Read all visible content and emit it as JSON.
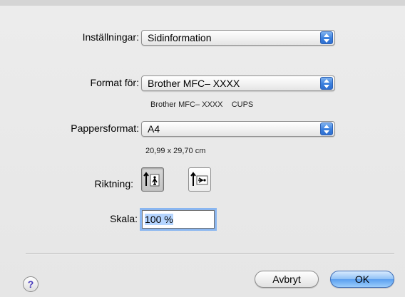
{
  "page_setup": {
    "settings_label": "Inställningar:",
    "settings_value": "Sidinformation",
    "format_for_label": "Format för:",
    "format_for_value": "Brother MFC– XXXX",
    "printer_info": "Brother MFC– XXXX    CUPS",
    "paper_size_label": "Pappersformat:",
    "paper_size_value": "A4",
    "paper_dimensions": "20,99 x 29,70 cm",
    "orientation_label": "Riktning:",
    "orientation_selected": "portrait",
    "scale_label": "Skala:",
    "scale_value": "100 %"
  },
  "footer": {
    "help_label": "?",
    "cancel_label": "Avbryt",
    "ok_label": "OK"
  },
  "icons": {
    "popup_arrows": "up-down-arrows-icon",
    "portrait": "portrait-orientation-icon",
    "landscape": "landscape-orientation-icon",
    "help": "help-icon"
  },
  "colors": {
    "accent_blue": "#3a7fdd",
    "focus_ring": "#8ab6f0",
    "help_text": "#4a3dbd"
  }
}
